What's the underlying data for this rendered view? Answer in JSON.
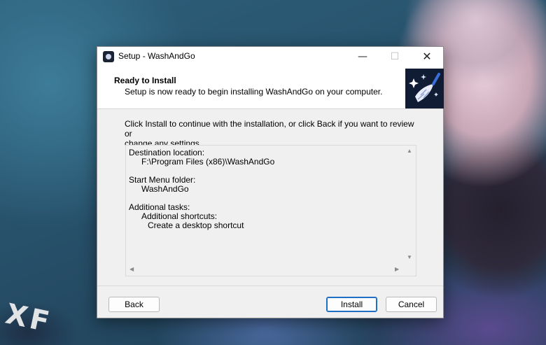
{
  "window": {
    "title": "Setup - WashAndGo",
    "minimize": "—",
    "maximize": "☐",
    "close": "✕"
  },
  "header": {
    "title": "Ready to Install",
    "subtitle": "Setup is now ready to begin installing WashAndGo on your computer."
  },
  "instructions": {
    "line1": "Click Install to continue with the installation, or click Back if you want to review or",
    "line2": "change any settings."
  },
  "summary": {
    "destination_label": "Destination location:",
    "destination_value": "F:\\Program Files (x86)\\WashAndGo",
    "start_menu_label": "Start Menu folder:",
    "start_menu_value": "WashAndGo",
    "tasks_label": "Additional tasks:",
    "tasks_group": "Additional shortcuts:",
    "tasks_item": "Create a desktop shortcut"
  },
  "buttons": {
    "back": "Back",
    "install": "Install",
    "cancel": "Cancel"
  },
  "wallpaper": {
    "watermark": "XF"
  },
  "icons": {
    "app": "washandgo-app-icon",
    "logo": "broom-sparkle-logo"
  },
  "colors": {
    "dialog_bg": "#f0f0f0",
    "accent": "#1f6fc5",
    "logo_bg": "#0f1c33"
  }
}
